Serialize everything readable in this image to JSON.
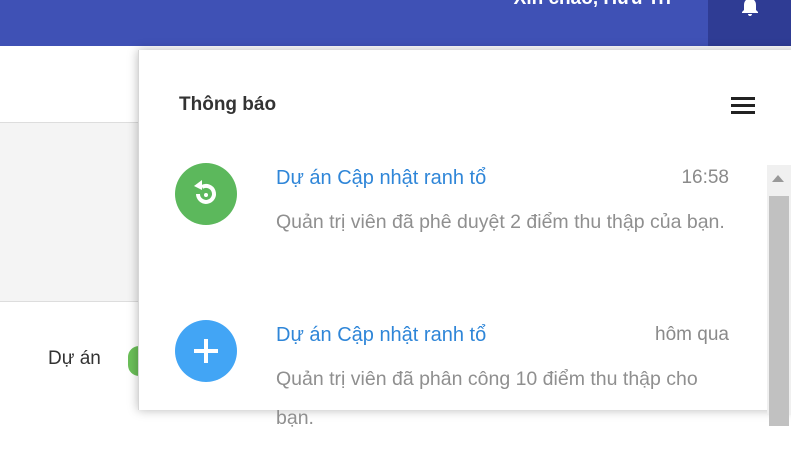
{
  "header": {
    "greeting": "Xin chào, Hữu Tri",
    "bell_icon": "bell-icon",
    "colors": {
      "bar": "#3f51b5",
      "bell_box": "#2f3c94"
    }
  },
  "background": {
    "label": "Dự án"
  },
  "notifications_panel": {
    "title": "Thông báo",
    "menu_icon": "hamburger-menu-icon",
    "items": [
      {
        "icon": "refresh-icon",
        "icon_color": "#5cb85c",
        "title": "Dự án Cập nhật ranh tổ",
        "time": "16:58",
        "body": "Quản trị viên đã phê duyệt 2 điểm thu thập của bạn."
      },
      {
        "icon": "plus-icon",
        "icon_color": "#42a5f5",
        "title": "Dự án Cập nhật ranh tổ",
        "time": "hôm qua",
        "body": "Quản trị viên đã phân công 10 điểm thu thập cho bạn."
      }
    ]
  }
}
